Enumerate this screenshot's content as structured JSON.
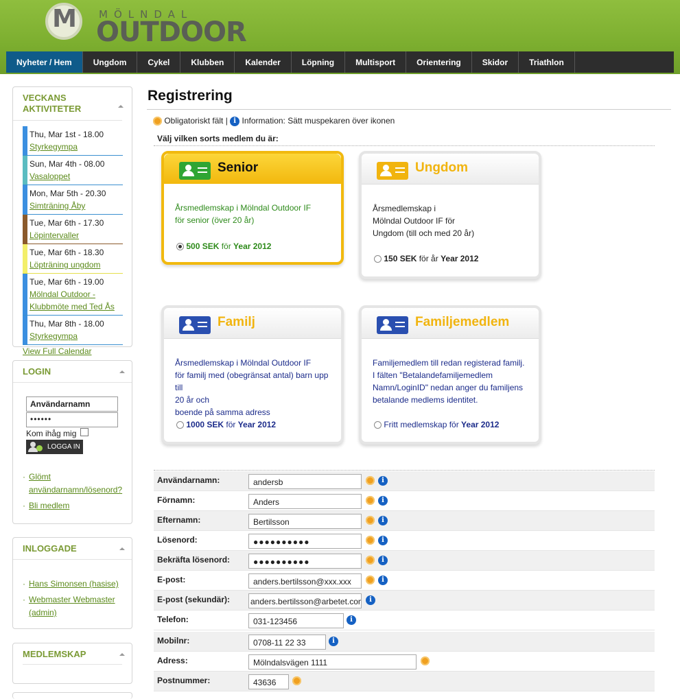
{
  "logo": {
    "letter": "M",
    "top": "MÖLNDAL",
    "big": "OUTDOOR"
  },
  "nav": [
    "Nyheter / Hem",
    "Ungdom",
    "Cykel",
    "Klubben",
    "Kalender",
    "Löpning",
    "Multisport",
    "Orientering",
    "Skidor",
    "Triathlon"
  ],
  "sidebar": {
    "activities_title": "VECKANS AKTIVITETER",
    "activities": [
      {
        "date": "Thu, Mar 1st - 18.00",
        "name": "Styrkegympa",
        "color": "#3b8fe0"
      },
      {
        "date": "Sun, Mar 4th - 08.00",
        "name": "Vasaloppet",
        "color": "#5bbcc1"
      },
      {
        "date": "Mon, Mar 5th - 20.30",
        "name": "Simträning Åby",
        "color": "#3b8fe0"
      },
      {
        "date": "Tue, Mar 6th - 17.30",
        "name": "Löpintervaller",
        "color": "#8b5a2b"
      },
      {
        "date": "Tue, Mar 6th - 18.30",
        "name": "Löpträning ungdom",
        "color": "#f3ef6a"
      },
      {
        "date": "Tue, Mar 6th - 19.00",
        "name": "Mölndal Outdoor - Klubbmöte med Ted Ås",
        "color": "#3b8fe0"
      },
      {
        "date": "Thu, Mar 8th - 18.00",
        "name": "Styrkegympa",
        "color": "#3b8fe0"
      }
    ],
    "calendar_link": "View Full Calendar",
    "login_title": "LOGIN",
    "username_placeholder": "Användarnamn",
    "password_dots": "••••••",
    "remember_label": "Kom ihåg mig",
    "login_button": "LOGGA IN",
    "login_links": [
      "Glömt användarnamn/lösenord?",
      "Bli medlem"
    ],
    "loggedin_title": "INLOGGADE",
    "loggedin_users": [
      "Hans Simonsen (hasise)",
      "Webmaster Webmaster (admin)"
    ],
    "membership_title": "MEDLEMSKAP"
  },
  "main": {
    "title": "Registrering",
    "legend_required": "Obligatoriskt fält |",
    "legend_info": "Information: Sätt muspekaren över ikonen",
    "choose_label": "Välj vilken sorts medlem du är:",
    "cards": [
      {
        "title": "Senior",
        "desc": [
          "Årsmedlemskap i Mölndal Outdoor IF",
          "för senior (över 20 år)"
        ],
        "price_amount": "500 SEK",
        "price_mid": " för ",
        "price_year": "Year 2012"
      },
      {
        "title": "Ungdom",
        "desc": [
          "Årsmedlemskap i",
          "Mölndal Outdoor IF för",
          "Ungdom (till och med 20 år)"
        ],
        "price_amount": "150 SEK",
        "price_mid": " för år ",
        "price_year": "Year 2012"
      },
      {
        "title": "Familj",
        "desc": [
          "Årsmedlemskap i Mölndal Outdoor IF",
          "för familj med (obegränsat antal) barn upp till",
          "20 år och",
          "boende på samma adress"
        ],
        "price_amount": "1000 SEK",
        "price_mid": " för ",
        "price_year": "Year 2012"
      },
      {
        "title": "Familjemedlem",
        "desc": [
          "Familjemedlem till redan registerad familj.",
          "I fälten \"Betalandefamiljemedlem",
          "Namn/LoginID\" nedan anger du familjens",
          "betalande medlems identitet."
        ],
        "price_amount": "Fritt medlemskap",
        "price_mid": " för ",
        "price_year": "Year 2012"
      }
    ],
    "form": [
      {
        "label": "Användarnamn:",
        "value": "andersb"
      },
      {
        "label": "Förnamn:",
        "value": "Anders"
      },
      {
        "label": "Efternamn:",
        "value": "Bertilsson"
      },
      {
        "label": "Lösenord:",
        "value": "●●●●●●●●●●"
      },
      {
        "label": "Bekräfta lösenord:",
        "value": "●●●●●●●●●●"
      },
      {
        "label": "E-post:",
        "value": "anders.bertilsson@xxx.xxx"
      },
      {
        "label": "E-post (sekundär):",
        "value": "anders.bertilsson@arbetet.com"
      },
      {
        "label": "Telefon:",
        "value": "031-123456"
      },
      {
        "label": "Mobilnr:",
        "value": "0708-11 22 33"
      },
      {
        "label": "Adress:",
        "value": "Mölndalsvägen 1111"
      },
      {
        "label": "Postnummer:",
        "value": "43636"
      }
    ]
  }
}
